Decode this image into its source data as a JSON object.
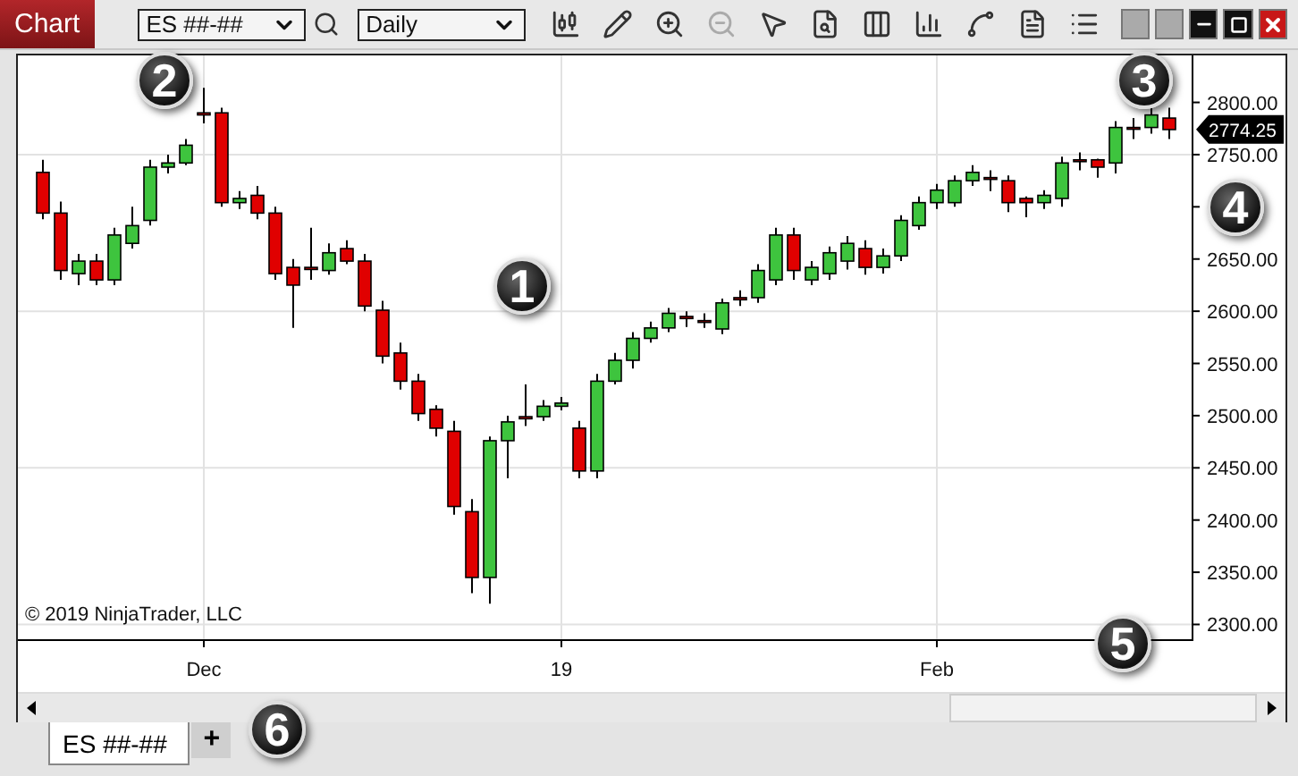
{
  "window": {
    "title": "Chart"
  },
  "toolbar": {
    "instrument": "ES ##-##",
    "interval": "Daily",
    "tools": [
      {
        "kind": "candles",
        "disabled": false
      },
      {
        "kind": "pencil",
        "disabled": false
      },
      {
        "kind": "zoom-in",
        "disabled": false
      },
      {
        "kind": "zoom-out",
        "disabled": true
      },
      {
        "kind": "pointer",
        "disabled": false
      },
      {
        "kind": "doc-search",
        "disabled": false
      },
      {
        "kind": "columns",
        "disabled": false
      },
      {
        "kind": "bars",
        "disabled": false
      },
      {
        "kind": "line",
        "disabled": false
      },
      {
        "kind": "doc",
        "disabled": false
      },
      {
        "kind": "list",
        "disabled": false
      }
    ]
  },
  "chart": {
    "copyright": "© 2019 NinjaTrader, LLC",
    "last_price": "2774.25",
    "x_axis_labels": [
      "Dec",
      "19",
      "Feb"
    ],
    "chart_data": {
      "type": "candlestick",
      "ylim": [
        2285,
        2845
      ],
      "grid": true,
      "yticks": [
        {
          "value": 2800,
          "label": "2800.00"
        },
        {
          "value": 2750,
          "label": "2750.00"
        },
        {
          "value": 2650,
          "label": "2650.00"
        },
        {
          "value": 2600,
          "label": "2600.00"
        },
        {
          "value": 2550,
          "label": "2550.00"
        },
        {
          "value": 2500,
          "label": "2500.00"
        },
        {
          "value": 2450,
          "label": "2450.00"
        },
        {
          "value": 2400,
          "label": "2400.00"
        },
        {
          "value": 2350,
          "label": "2350.00"
        },
        {
          "value": 2300,
          "label": "2300.00"
        }
      ],
      "ohlc": [
        [
          2733,
          2745,
          2688,
          2694
        ],
        [
          2694,
          2705,
          2630,
          2639
        ],
        [
          2636,
          2655,
          2625,
          2648
        ],
        [
          2648,
          2655,
          2625,
          2630
        ],
        [
          2630,
          2680,
          2625,
          2673
        ],
        [
          2665,
          2700,
          2660,
          2682
        ],
        [
          2687,
          2745,
          2682,
          2738
        ],
        [
          2738,
          2750,
          2732,
          2742
        ],
        [
          2742,
          2765,
          2740,
          2759
        ],
        [
          2790,
          2814,
          2780,
          2788
        ],
        [
          2790,
          2795,
          2700,
          2704
        ],
        [
          2704,
          2715,
          2698,
          2708
        ],
        [
          2711,
          2720,
          2688,
          2694
        ],
        [
          2694,
          2700,
          2630,
          2636
        ],
        [
          2642,
          2650,
          2584,
          2625
        ],
        [
          2642,
          2680,
          2630,
          2640
        ],
        [
          2639,
          2665,
          2635,
          2656
        ],
        [
          2660,
          2668,
          2645,
          2648
        ],
        [
          2648,
          2655,
          2600,
          2605
        ],
        [
          2601,
          2610,
          2550,
          2557
        ],
        [
          2560,
          2570,
          2525,
          2533
        ],
        [
          2533,
          2540,
          2495,
          2502
        ],
        [
          2506,
          2510,
          2480,
          2488
        ],
        [
          2485,
          2495,
          2405,
          2413
        ],
        [
          2408,
          2420,
          2330,
          2345
        ],
        [
          2345,
          2480,
          2320,
          2476
        ],
        [
          2476,
          2500,
          2440,
          2494
        ],
        [
          2499,
          2530,
          2490,
          2497
        ],
        [
          2499,
          2515,
          2495,
          2509
        ],
        [
          2509,
          2518,
          2505,
          2512
        ],
        [
          2488,
          2495,
          2440,
          2447
        ],
        [
          2447,
          2540,
          2440,
          2533
        ],
        [
          2533,
          2560,
          2530,
          2553
        ],
        [
          2553,
          2580,
          2545,
          2574
        ],
        [
          2574,
          2590,
          2570,
          2584
        ],
        [
          2584,
          2603,
          2580,
          2598
        ],
        [
          2595,
          2600,
          2585,
          2593
        ],
        [
          2591,
          2598,
          2584,
          2590
        ],
        [
          2583,
          2612,
          2578,
          2608
        ],
        [
          2613,
          2620,
          2605,
          2611
        ],
        [
          2613,
          2645,
          2608,
          2639
        ],
        [
          2630,
          2680,
          2625,
          2673
        ],
        [
          2673,
          2680,
          2630,
          2639
        ],
        [
          2630,
          2648,
          2625,
          2642
        ],
        [
          2636,
          2662,
          2630,
          2656
        ],
        [
          2648,
          2672,
          2640,
          2665
        ],
        [
          2660,
          2668,
          2635,
          2642
        ],
        [
          2642,
          2660,
          2636,
          2653
        ],
        [
          2653,
          2692,
          2648,
          2687
        ],
        [
          2682,
          2710,
          2678,
          2704
        ],
        [
          2704,
          2722,
          2698,
          2716
        ],
        [
          2704,
          2730,
          2700,
          2725
        ],
        [
          2725,
          2740,
          2720,
          2733
        ],
        [
          2728,
          2735,
          2715,
          2727
        ],
        [
          2725,
          2730,
          2695,
          2704
        ],
        [
          2708,
          2710,
          2690,
          2704
        ],
        [
          2704,
          2716,
          2698,
          2711
        ],
        [
          2708,
          2748,
          2700,
          2742
        ],
        [
          2745,
          2752,
          2735,
          2744
        ],
        [
          2745,
          2746,
          2728,
          2738
        ],
        [
          2742,
          2782,
          2732,
          2776
        ],
        [
          2776,
          2785,
          2765,
          2775
        ],
        [
          2776,
          2795,
          2770,
          2788
        ],
        [
          2785,
          2795,
          2765,
          2774
        ]
      ]
    }
  },
  "callouts": [
    "1",
    "2",
    "3",
    "4",
    "5",
    "6"
  ],
  "tabs": [
    {
      "label": "ES ##-##",
      "selected": true
    }
  ],
  "add_tab": "+"
}
